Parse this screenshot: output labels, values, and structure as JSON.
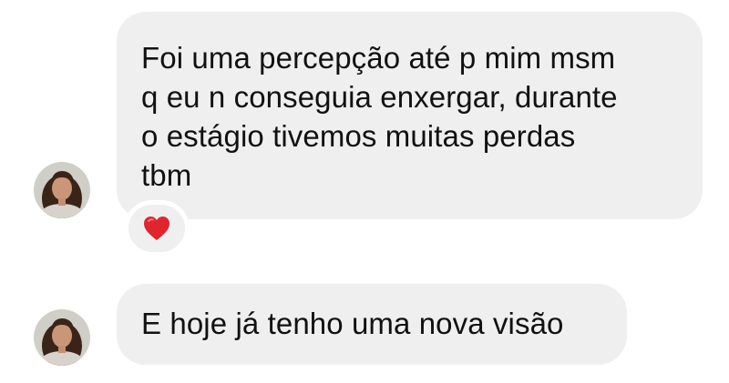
{
  "conversation": {
    "messages": [
      {
        "lines": [
          "Foi uma percepção até p mim msm",
          "q eu n conseguia enxergar, durante",
          "o estágio tivemos muitas perdas",
          "tbm"
        ],
        "reaction": "heart-icon"
      },
      {
        "lines": [
          "E hoje já tenho uma nova visão"
        ]
      }
    ]
  },
  "colors": {
    "bubble": "#efefef",
    "text": "#111111",
    "heart": "#e0252f"
  }
}
